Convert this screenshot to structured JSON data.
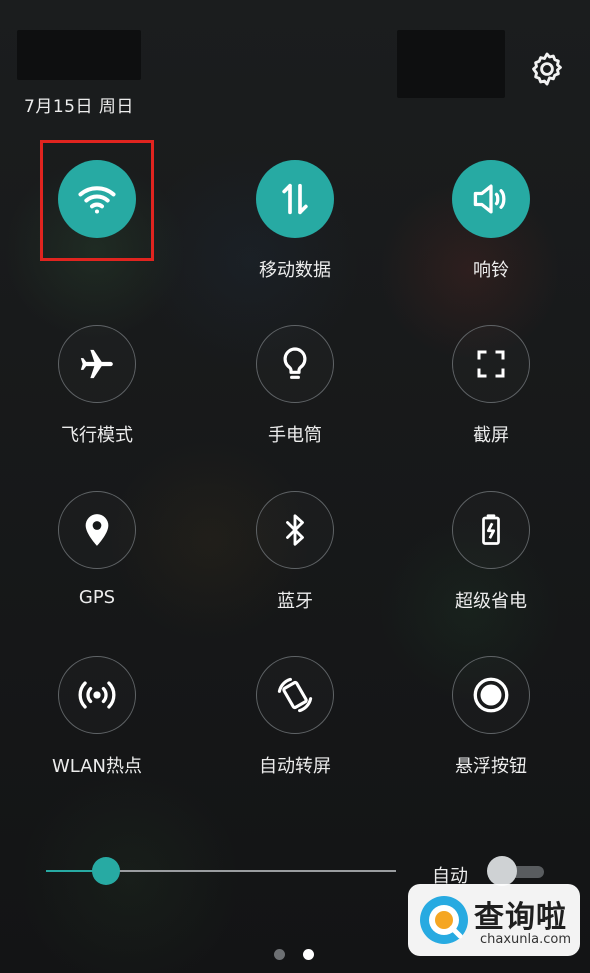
{
  "header": {
    "date_text": "7月15日 周日"
  },
  "quick_settings": [
    {
      "id": "wifi",
      "label": "",
      "state": "on",
      "icon": "wifi-icon"
    },
    {
      "id": "mobile-data",
      "label": "移动数据",
      "state": "on",
      "icon": "mobile-data-icon"
    },
    {
      "id": "ring",
      "label": "响铃",
      "state": "on",
      "icon": "speaker-icon"
    },
    {
      "id": "airplane",
      "label": "飞行模式",
      "state": "off",
      "icon": "airplane-icon"
    },
    {
      "id": "flashlight",
      "label": "手电筒",
      "state": "off",
      "icon": "flashlight-icon"
    },
    {
      "id": "screenshot",
      "label": "截屏",
      "state": "off",
      "icon": "screenshot-icon"
    },
    {
      "id": "gps",
      "label": "GPS",
      "state": "off",
      "icon": "location-pin-icon"
    },
    {
      "id": "bluetooth",
      "label": "蓝牙",
      "state": "off",
      "icon": "bluetooth-icon"
    },
    {
      "id": "power-saving",
      "label": "超级省电",
      "state": "off",
      "icon": "battery-charging-icon"
    },
    {
      "id": "hotspot",
      "label": "WLAN热点",
      "state": "off",
      "icon": "hotspot-icon"
    },
    {
      "id": "auto-rotate",
      "label": "自动转屏",
      "state": "off",
      "icon": "rotate-icon"
    },
    {
      "id": "floating-button",
      "label": "悬浮按钮",
      "state": "off",
      "icon": "floating-button-icon"
    }
  ],
  "brightness": {
    "level": 0.17,
    "auto_label": "自动",
    "auto_enabled": false
  },
  "pager": {
    "pages": 2,
    "current": 2
  },
  "watermark": {
    "title": "查询啦",
    "url": "chaxunla.com"
  },
  "colors": {
    "accent": "#27aaa3",
    "highlight": "#e0241f"
  }
}
